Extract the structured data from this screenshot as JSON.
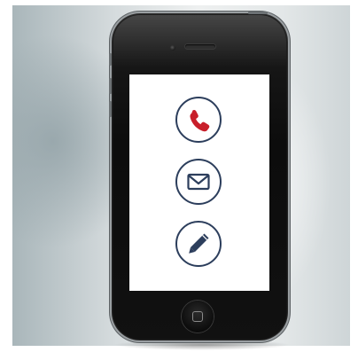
{
  "scene": {
    "subject": "smartphone",
    "colors": {
      "phone_body": "#111111",
      "screen": "#ffffff",
      "icon_outline": "#2c3e5c",
      "phone_icon_accent": "#c81f2a"
    }
  },
  "screen_icons": [
    {
      "icon": "phone-icon",
      "color": "#c81f2a"
    },
    {
      "icon": "envelope-icon",
      "color": "#2c3e5c"
    },
    {
      "icon": "pencil-icon",
      "color": "#2c3e5c"
    }
  ]
}
